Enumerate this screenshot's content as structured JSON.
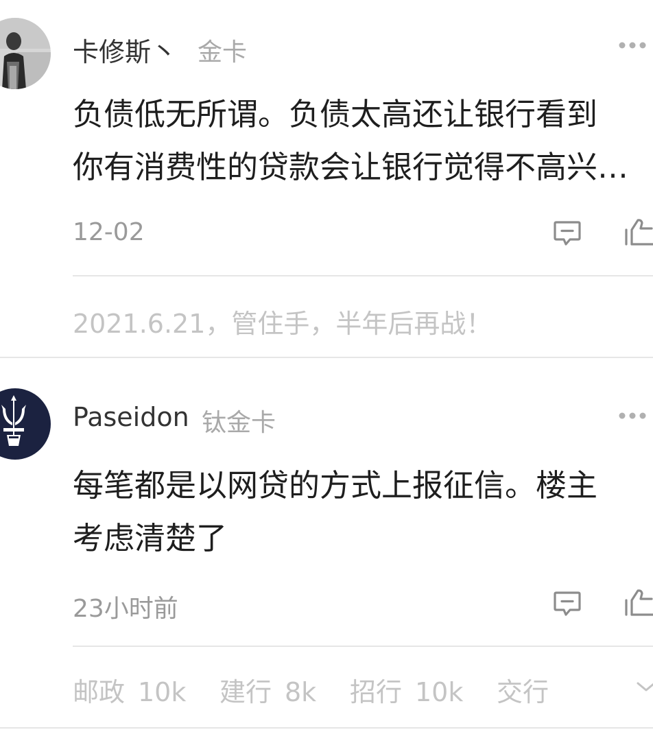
{
  "comments": [
    {
      "username": "卡修斯丶",
      "badge": "金卡",
      "avatar_icon": "person-photo-avatar",
      "text_lines": [
        "负债低无所谓。负债太高还让银行看到",
        "你有消费性的贷款会让银行觉得不高兴…"
      ],
      "time": "12-02",
      "signature": "2021.6.21，管住手，半年后再战！"
    },
    {
      "username": "Paseidon",
      "badge": "钛金卡",
      "avatar_icon": "trident-logo-avatar",
      "text_lines": [
        "每笔都是以网贷的方式上报征信。楼主",
        "考虑清楚了"
      ],
      "time": "23小时前",
      "signature_tags": [
        "邮政_10k",
        "建行_8k",
        "招行_10k",
        "交行"
      ]
    }
  ],
  "icons": {
    "more": "more-dots-icon",
    "reply": "comment-reply-icon",
    "like": "thumbs-up-icon",
    "expand": "chevron-down-icon"
  },
  "colors": {
    "username": "#333333",
    "badge": "#a9a9a9",
    "body_text": "#1e1e1e",
    "time": "#9a9a9a",
    "signature": "#c4c4c4",
    "divider": "#e6e6e6",
    "icon": "#8c8c8c",
    "avatar_navy": "#1b2240"
  }
}
